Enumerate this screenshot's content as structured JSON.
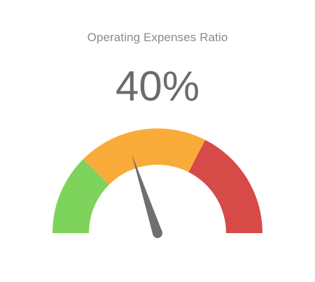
{
  "chart_data": {
    "type": "gauge",
    "title": "Operating Expenses Ratio",
    "value": 40,
    "value_label": "40%",
    "min": 0,
    "max": 100,
    "bands": [
      {
        "from": 0,
        "to": 25,
        "color": "#7dd35b"
      },
      {
        "from": 25,
        "to": 65,
        "color": "#f9ab39"
      },
      {
        "from": 65,
        "to": 100,
        "color": "#d64a47"
      }
    ],
    "needle_color": "#6f6f6f"
  }
}
